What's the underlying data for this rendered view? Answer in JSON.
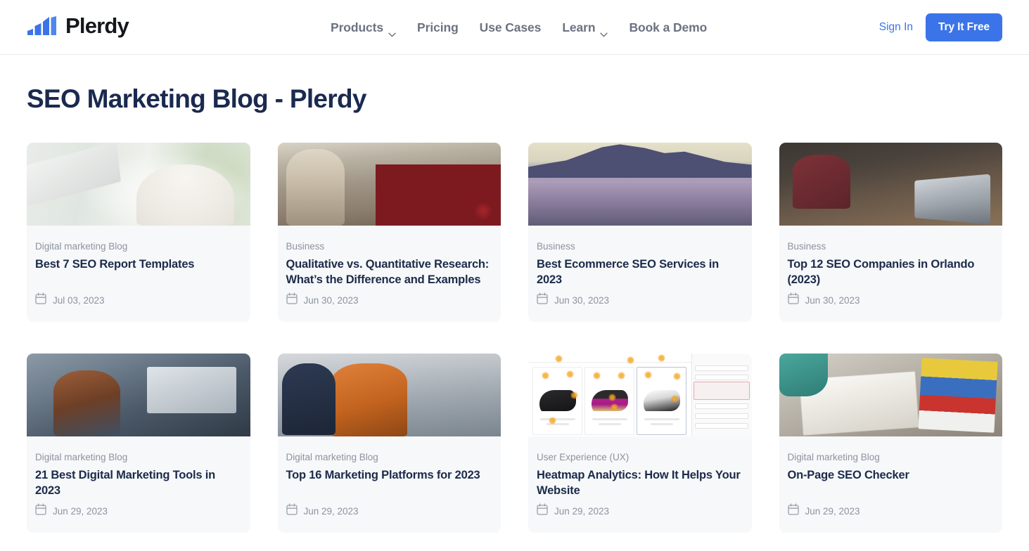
{
  "header": {
    "brand": {
      "name": "Plerdy",
      "logo_icon": "bar-chart-logo-icon",
      "flag_icon": "ukraine-flag-icon"
    },
    "nav": [
      {
        "label": "Products",
        "has_dropdown": true
      },
      {
        "label": "Pricing",
        "has_dropdown": false
      },
      {
        "label": "Use Cases",
        "has_dropdown": false
      },
      {
        "label": "Learn",
        "has_dropdown": true
      },
      {
        "label": "Book a Demo",
        "has_dropdown": false
      }
    ],
    "sign_in_label": "Sign In",
    "cta_label": "Try It Free"
  },
  "page": {
    "title": "SEO Marketing Blog - Plerdy"
  },
  "colors": {
    "accent": "#3b74e8",
    "title": "#1a2a4f",
    "muted": "#8d939e",
    "card_bg": "#f6f8fa",
    "flag_blue": "#2b5bb5",
    "flag_yellow": "#f5cf2e"
  },
  "posts": [
    {
      "category": "Digital marketing Blog",
      "title": "Best 7 SEO Report Templates",
      "date": "Jul 03, 2023",
      "thumb": "office-woman-document-photo",
      "date_icon": "calendar-icon"
    },
    {
      "category": "Business",
      "title": "Qualitative vs. Quantitative Research: What’s the Difference and Examples",
      "date": "Jun 30, 2023",
      "thumb": "market-fruit-stall-photo",
      "date_icon": "calendar-icon"
    },
    {
      "category": "Business",
      "title": "Best Ecommerce SEO Services in 2023",
      "date": "Jun 30, 2023",
      "thumb": "mountain-fog-photo",
      "date_icon": "calendar-icon"
    },
    {
      "category": "Business",
      "title": "Top 12 SEO Companies in Orlando (2023)",
      "date": "Jun 30, 2023",
      "thumb": "office-meeting-laptops-photo",
      "date_icon": "calendar-icon"
    },
    {
      "category": "Digital marketing Blog",
      "title": "21 Best Digital Marketing Tools in 2023",
      "date": "Jun 29, 2023",
      "thumb": "woman-at-desk-monitors-photo",
      "date_icon": "calendar-icon"
    },
    {
      "category": "Digital marketing Blog",
      "title": "Top 16 Marketing Platforms for 2023",
      "date": "Jun 29, 2023",
      "thumb": "two-men-electronics-store-photo",
      "date_icon": "calendar-icon"
    },
    {
      "category": "User Experience (UX)",
      "title": "Heatmap Analytics: How It Helps Your Website",
      "date": "Jun 29, 2023",
      "thumb": "heatmap-ecommerce-screenshot",
      "date_icon": "calendar-icon"
    },
    {
      "category": "Digital marketing Blog",
      "title": "On-Page SEO Checker",
      "date": "Jun 29, 2023",
      "thumb": "open-book-magazines-photo",
      "date_icon": "calendar-icon"
    }
  ]
}
